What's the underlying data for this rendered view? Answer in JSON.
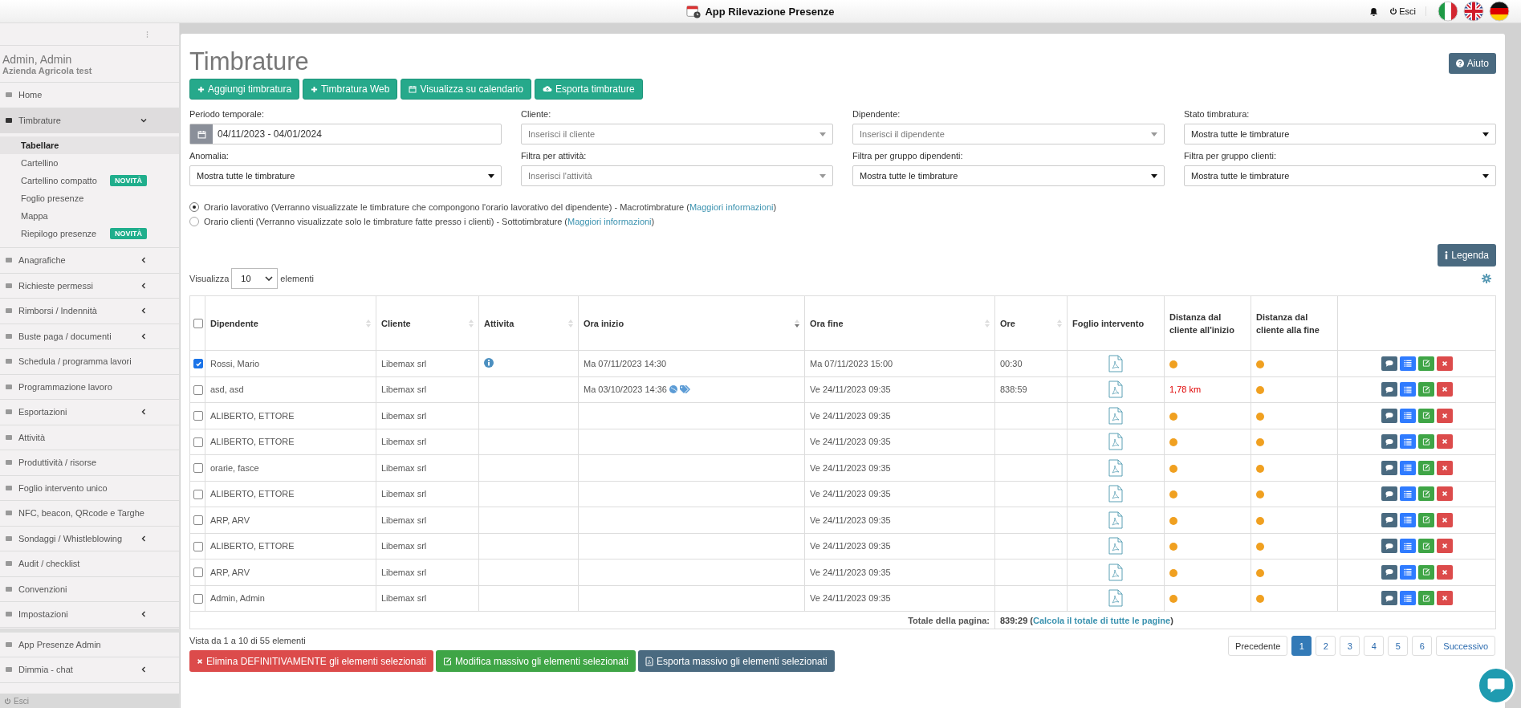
{
  "topbar": {
    "title": "App Rilevazione Presenze",
    "logout": "Esci",
    "flags": [
      {
        "kind": "it"
      },
      {
        "kind": "gb"
      },
      {
        "kind": "de"
      }
    ]
  },
  "sidebar": {
    "user": "Admin, Admin",
    "company": "Azienda Agricola test",
    "items": [
      {
        "label": "Home",
        "submenu": false,
        "expanded": false
      },
      {
        "label": "Timbrature",
        "submenu": true,
        "expanded": true,
        "children": [
          {
            "label": "Tabellare",
            "selected": true
          },
          {
            "label": "Cartellino",
            "selected": false
          },
          {
            "label": "Cartellino compatto",
            "selected": false,
            "badge": "NOVITÀ"
          },
          {
            "label": "Foglio presenze",
            "selected": false
          },
          {
            "label": "Mappa",
            "selected": false
          },
          {
            "label": "Riepilogo presenze",
            "selected": false,
            "badge": "NOVITÀ"
          }
        ]
      },
      {
        "label": "Anagrafiche",
        "submenu": true,
        "expanded": false
      },
      {
        "label": "Richieste permessi",
        "submenu": true,
        "expanded": false
      },
      {
        "label": "Rimborsi / Indennità",
        "submenu": true,
        "expanded": false
      },
      {
        "label": "Buste paga / documenti",
        "submenu": true,
        "expanded": false
      },
      {
        "label": "Schedula / programma lavori",
        "submenu": false,
        "expanded": false
      },
      {
        "label": "Programmazione lavoro",
        "submenu": false,
        "expanded": false
      },
      {
        "label": "Esportazioni",
        "submenu": true,
        "expanded": false
      },
      {
        "label": "Attività",
        "submenu": false,
        "expanded": false
      },
      {
        "label": "Produttività / risorse",
        "submenu": false,
        "expanded": false
      },
      {
        "label": "Foglio intervento unico",
        "submenu": false,
        "expanded": false
      },
      {
        "label": "NFC, beacon, QRcode e Targhe",
        "submenu": false,
        "expanded": false
      },
      {
        "label": "Sondaggi / Whistleblowing",
        "submenu": true,
        "expanded": false
      },
      {
        "label": "Audit / checklist",
        "submenu": false,
        "expanded": false
      },
      {
        "label": "Convenzioni",
        "submenu": false,
        "expanded": false
      },
      {
        "label": "Impostazioni",
        "submenu": true,
        "expanded": false
      }
    ],
    "bottom_items": [
      {
        "label": "App Presenze Admin",
        "submenu": false
      },
      {
        "label": "Dimmia - chat",
        "submenu": true
      }
    ],
    "footer": "Esci"
  },
  "page": {
    "title": "Timbrature",
    "help_button": "Aiuto",
    "actions": [
      {
        "label": "Aggiungi timbratura",
        "kind": "plus"
      },
      {
        "label": "Timbratura Web",
        "kind": "plus"
      },
      {
        "label": "Visualizza su calendario",
        "kind": "calendar"
      },
      {
        "label": "Esporta timbrature",
        "kind": "cloud"
      }
    ],
    "filters": [
      {
        "label": "Periodo temporale:",
        "kind": "date",
        "value": "04/11/2023 - 04/01/2024"
      },
      {
        "label": "Cliente:",
        "kind": "search",
        "placeholder": "Inserisci il cliente"
      },
      {
        "label": "Dipendente:",
        "kind": "search",
        "placeholder": "Inserisci il dipendente"
      },
      {
        "label": "Stato timbratura:",
        "kind": "select",
        "value": "Mostra tutte le timbrature"
      },
      {
        "label": "Anomalia:",
        "kind": "select",
        "value": "Mostra tutte le timbrature"
      },
      {
        "label": "Filtra per attività:",
        "kind": "search",
        "placeholder": "Inserisci l'attività"
      },
      {
        "label": "Filtra per gruppo dipendenti:",
        "kind": "select",
        "value": "Mostra tutte le timbrature"
      },
      {
        "label": "Filtra per gruppo clienti:",
        "kind": "select",
        "value": "Mostra tutte le timbrature"
      }
    ],
    "modes": [
      {
        "selected": true,
        "text": "Orario lavorativo (Verranno visualizzate le timbrature che compongono l'orario lavorativo del dipendente) - Macrotimbrature (",
        "link": "Maggiori informazioni",
        "after": ")"
      },
      {
        "selected": false,
        "text": "Orario clienti (Verranno visualizzate solo le timbrature fatte presso i clienti) - Sottotimbrature (",
        "link": "Maggiori informazioni",
        "after": ")"
      }
    ],
    "legend_button": "Legenda",
    "length": {
      "before": "Visualizza",
      "value": "10",
      "after": "elementi"
    }
  },
  "table": {
    "all_checked": false,
    "columns": [
      {
        "label": "Dipendente",
        "sortable": true,
        "sorted_desc": false
      },
      {
        "label": "Cliente",
        "sortable": true,
        "sorted_desc": false
      },
      {
        "label": "Attivita",
        "sortable": true,
        "sorted_desc": false
      },
      {
        "label": "Ora inizio",
        "sortable": true,
        "sorted_desc": true
      },
      {
        "label": "Ora fine",
        "sortable": true,
        "sorted_desc": false
      },
      {
        "label": "Ore",
        "sortable": true,
        "sorted_desc": false
      },
      {
        "label": "Foglio intervento",
        "sortable": false
      },
      {
        "label": "Distanza dal cliente all'inizio",
        "sortable": false
      },
      {
        "label": "Distanza dal cliente alla fine",
        "sortable": false
      }
    ],
    "rows": [
      {
        "checked": true,
        "employee": "Rossi, Mario",
        "client": "Libemax srl",
        "activity_info": true,
        "start": "Ma 07/11/2023 14:30",
        "start_marks": false,
        "end": "Ma 07/11/2023 15:00",
        "hours": "00:30",
        "start_distance": {
          "kind": "dot"
        },
        "end_distance": {
          "kind": "dot"
        }
      },
      {
        "checked": false,
        "employee": "asd, asd",
        "client": "Libemax srl",
        "activity_info": false,
        "start": "Ma 03/10/2023 14:36",
        "start_marks": true,
        "end": "Ve 24/11/2023 09:35",
        "hours": "838:59",
        "start_distance": {
          "kind": "text",
          "text": "1,78 km"
        },
        "end_distance": {
          "kind": "dot"
        }
      },
      {
        "checked": false,
        "employee": "ALIBERTO, ETTORE",
        "client": "Libemax srl",
        "activity_info": false,
        "start_marks": false,
        "end": "Ve 24/11/2023 09:35",
        "start_distance": {
          "kind": "dot"
        },
        "end_distance": {
          "kind": "dot"
        }
      },
      {
        "checked": false,
        "employee": "ALIBERTO, ETTORE",
        "client": "Libemax srl",
        "activity_info": false,
        "start_marks": false,
        "end": "Ve 24/11/2023 09:35",
        "start_distance": {
          "kind": "dot"
        },
        "end_distance": {
          "kind": "dot"
        }
      },
      {
        "checked": false,
        "employee": "orarie, fasce",
        "client": "Libemax srl",
        "activity_info": false,
        "start_marks": false,
        "end": "Ve 24/11/2023 09:35",
        "start_distance": {
          "kind": "dot"
        },
        "end_distance": {
          "kind": "dot"
        }
      },
      {
        "checked": false,
        "employee": "ALIBERTO, ETTORE",
        "client": "Libemax srl",
        "activity_info": false,
        "start_marks": false,
        "end": "Ve 24/11/2023 09:35",
        "start_distance": {
          "kind": "dot"
        },
        "end_distance": {
          "kind": "dot"
        }
      },
      {
        "checked": false,
        "employee": "ARP, ARV",
        "client": "Libemax srl",
        "activity_info": false,
        "start_marks": false,
        "end": "Ve 24/11/2023 09:35",
        "start_distance": {
          "kind": "dot"
        },
        "end_distance": {
          "kind": "dot"
        }
      },
      {
        "checked": false,
        "employee": "ALIBERTO, ETTORE",
        "client": "Libemax srl",
        "activity_info": false,
        "start_marks": false,
        "end": "Ve 24/11/2023 09:35",
        "start_distance": {
          "kind": "dot"
        },
        "end_distance": {
          "kind": "dot"
        }
      },
      {
        "checked": false,
        "employee": "ARP, ARV",
        "client": "Libemax srl",
        "activity_info": false,
        "start_marks": false,
        "end": "Ve 24/11/2023 09:35",
        "start_distance": {
          "kind": "dot"
        },
        "end_distance": {
          "kind": "dot"
        }
      },
      {
        "checked": false,
        "employee": "Admin, Admin",
        "client": "Libemax srl",
        "activity_info": false,
        "start_marks": false,
        "end": "Ve 24/11/2023 09:35",
        "start_distance": {
          "kind": "dot"
        },
        "end_distance": {
          "kind": "dot"
        }
      }
    ],
    "total": {
      "label": "Totale della pagina:",
      "value": "839:29 (",
      "link": "Calcola il totale di tutte le pagine",
      "after": ")"
    }
  },
  "footer": {
    "info": "Vista da 1 a 10 di 55 elementi",
    "pagination": {
      "previous": "Precedente",
      "next": "Successivo",
      "pages": [
        {
          "label": "1",
          "selected": true
        },
        {
          "label": "2",
          "selected": false
        },
        {
          "label": "3",
          "selected": false
        },
        {
          "label": "4",
          "selected": false
        },
        {
          "label": "5",
          "selected": false
        },
        {
          "label": "6",
          "selected": false
        }
      ]
    },
    "bulk": [
      {
        "label": "Elimina DEFINITIVAMENTE gli elementi selezionati",
        "kind": "delete"
      },
      {
        "label": "Modifica massivo gli elementi selezionati",
        "kind": "edit"
      },
      {
        "label": "Esporta massivo gli elementi selezionati",
        "kind": "export"
      }
    ]
  }
}
